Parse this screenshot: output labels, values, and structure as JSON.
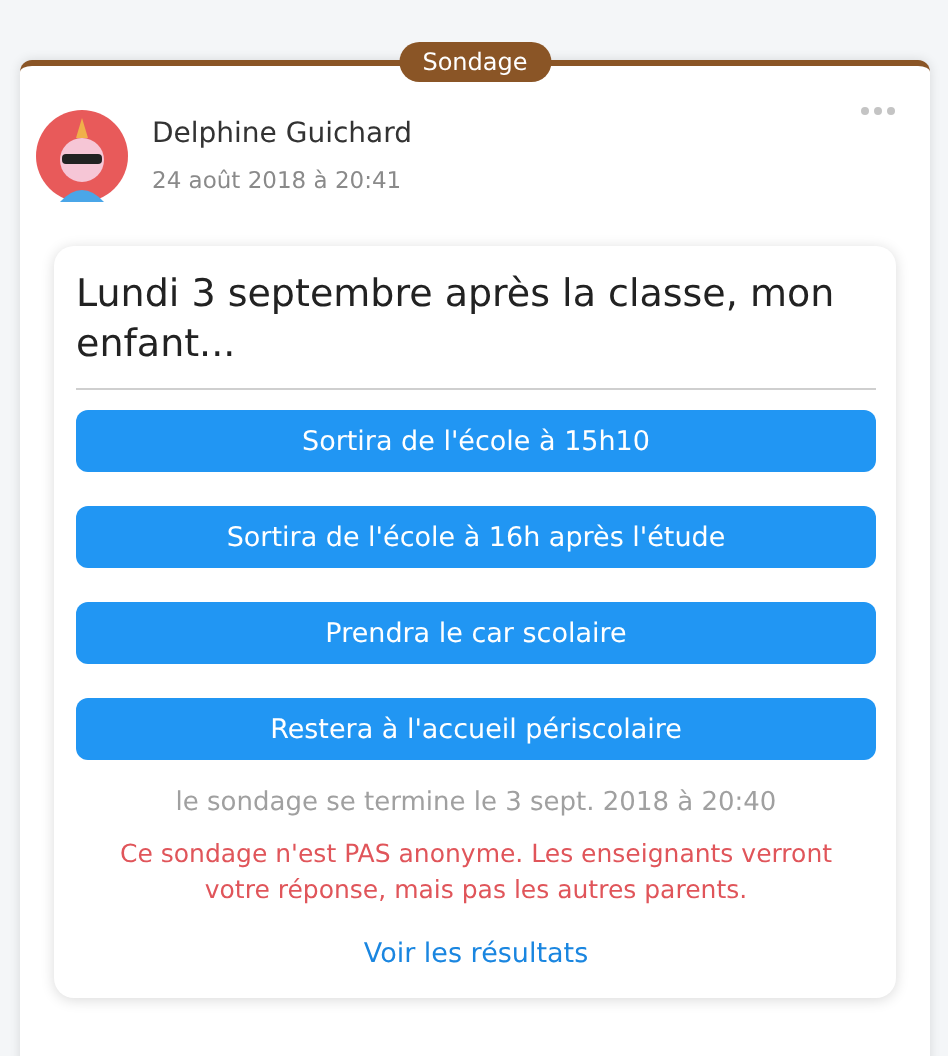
{
  "post": {
    "badge": "Sondage",
    "author": "Delphine Guichard",
    "date": "24 août 2018 à 20:41"
  },
  "poll": {
    "question": "Lundi 3 septembre après la classe, mon enfant...",
    "options": [
      {
        "label": "Sortira de l'école à 15h10",
        "selected": false
      },
      {
        "label": "Sortira de l'école à 16h après l'étude",
        "selected": false
      },
      {
        "label": "Prendra le car scolaire",
        "selected": false
      },
      {
        "label": "Restera à l'accueil périscolaire",
        "selected": false
      }
    ],
    "end_note": "le sondage se termine le 3 sept. 2018 à 20:40",
    "warning": "Ce sondage n'est PAS anonyme. Les enseignants verront votre réponse, mais pas les autres parents.",
    "results_link": "Voir les résultats"
  }
}
